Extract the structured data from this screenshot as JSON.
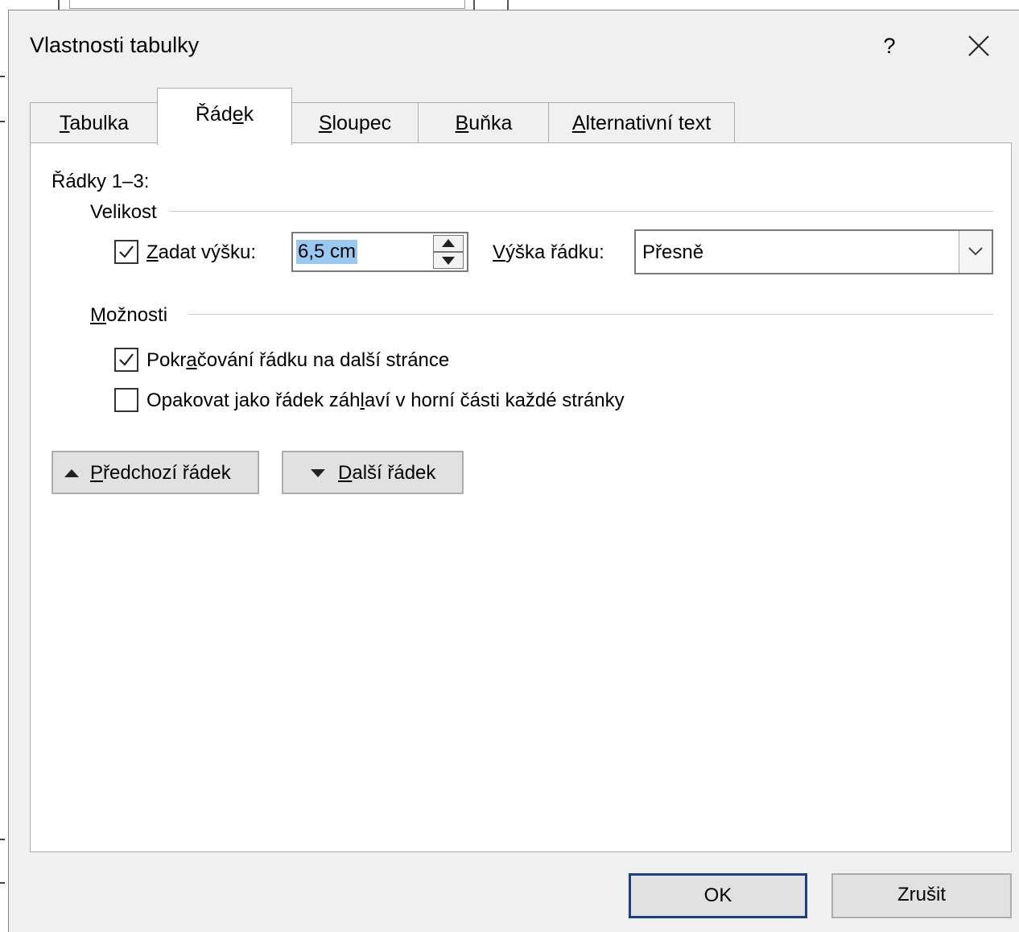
{
  "dialog": {
    "title": "Vlastnosti tabulky",
    "help_label": "?"
  },
  "tabs": [
    {
      "label": "Tabulka",
      "mnemonic": "T",
      "rest": "abulka",
      "active": false
    },
    {
      "label": "Řádek",
      "pre": "Řád",
      "mnemonic": "e",
      "rest": "k",
      "active": true
    },
    {
      "label": "Sloupec",
      "mnemonic": "S",
      "rest": "loupec",
      "active": false
    },
    {
      "label": "Buňka",
      "mnemonic": "B",
      "rest": "uňka",
      "active": false
    },
    {
      "label": "Alternativní text",
      "mnemonic": "A",
      "rest": "lternativní text",
      "active": false
    }
  ],
  "panel": {
    "rows_label": "Řádky 1–3:",
    "size_group": {
      "label": "Velikost",
      "specify_height": {
        "checked": true,
        "mnemonic": "Z",
        "rest": "adat výšku:"
      },
      "height_value": "6,5 cm",
      "row_height_label": {
        "mnemonic": "V",
        "rest": "ýška řádku:"
      },
      "row_height_mode": "Přesně"
    },
    "options_group": {
      "label_mnemonic": "M",
      "label_rest": "ožnosti",
      "allow_break": {
        "checked": true,
        "pre": "Pokr",
        "mnemonic": "a",
        "rest": "čování řádku na další stránce"
      },
      "repeat_header": {
        "checked": false,
        "pre": "Opakovat jako řádek záh",
        "mnemonic": "l",
        "rest": "aví v horní části každé stránky"
      }
    },
    "prev_row_button": {
      "mnemonic": "P",
      "rest": "ředchozí řádek"
    },
    "next_row_button": {
      "mnemonic": "D",
      "rest": "alší řádek"
    }
  },
  "footer": {
    "ok_label": "OK",
    "cancel_label": "Zrušit"
  }
}
